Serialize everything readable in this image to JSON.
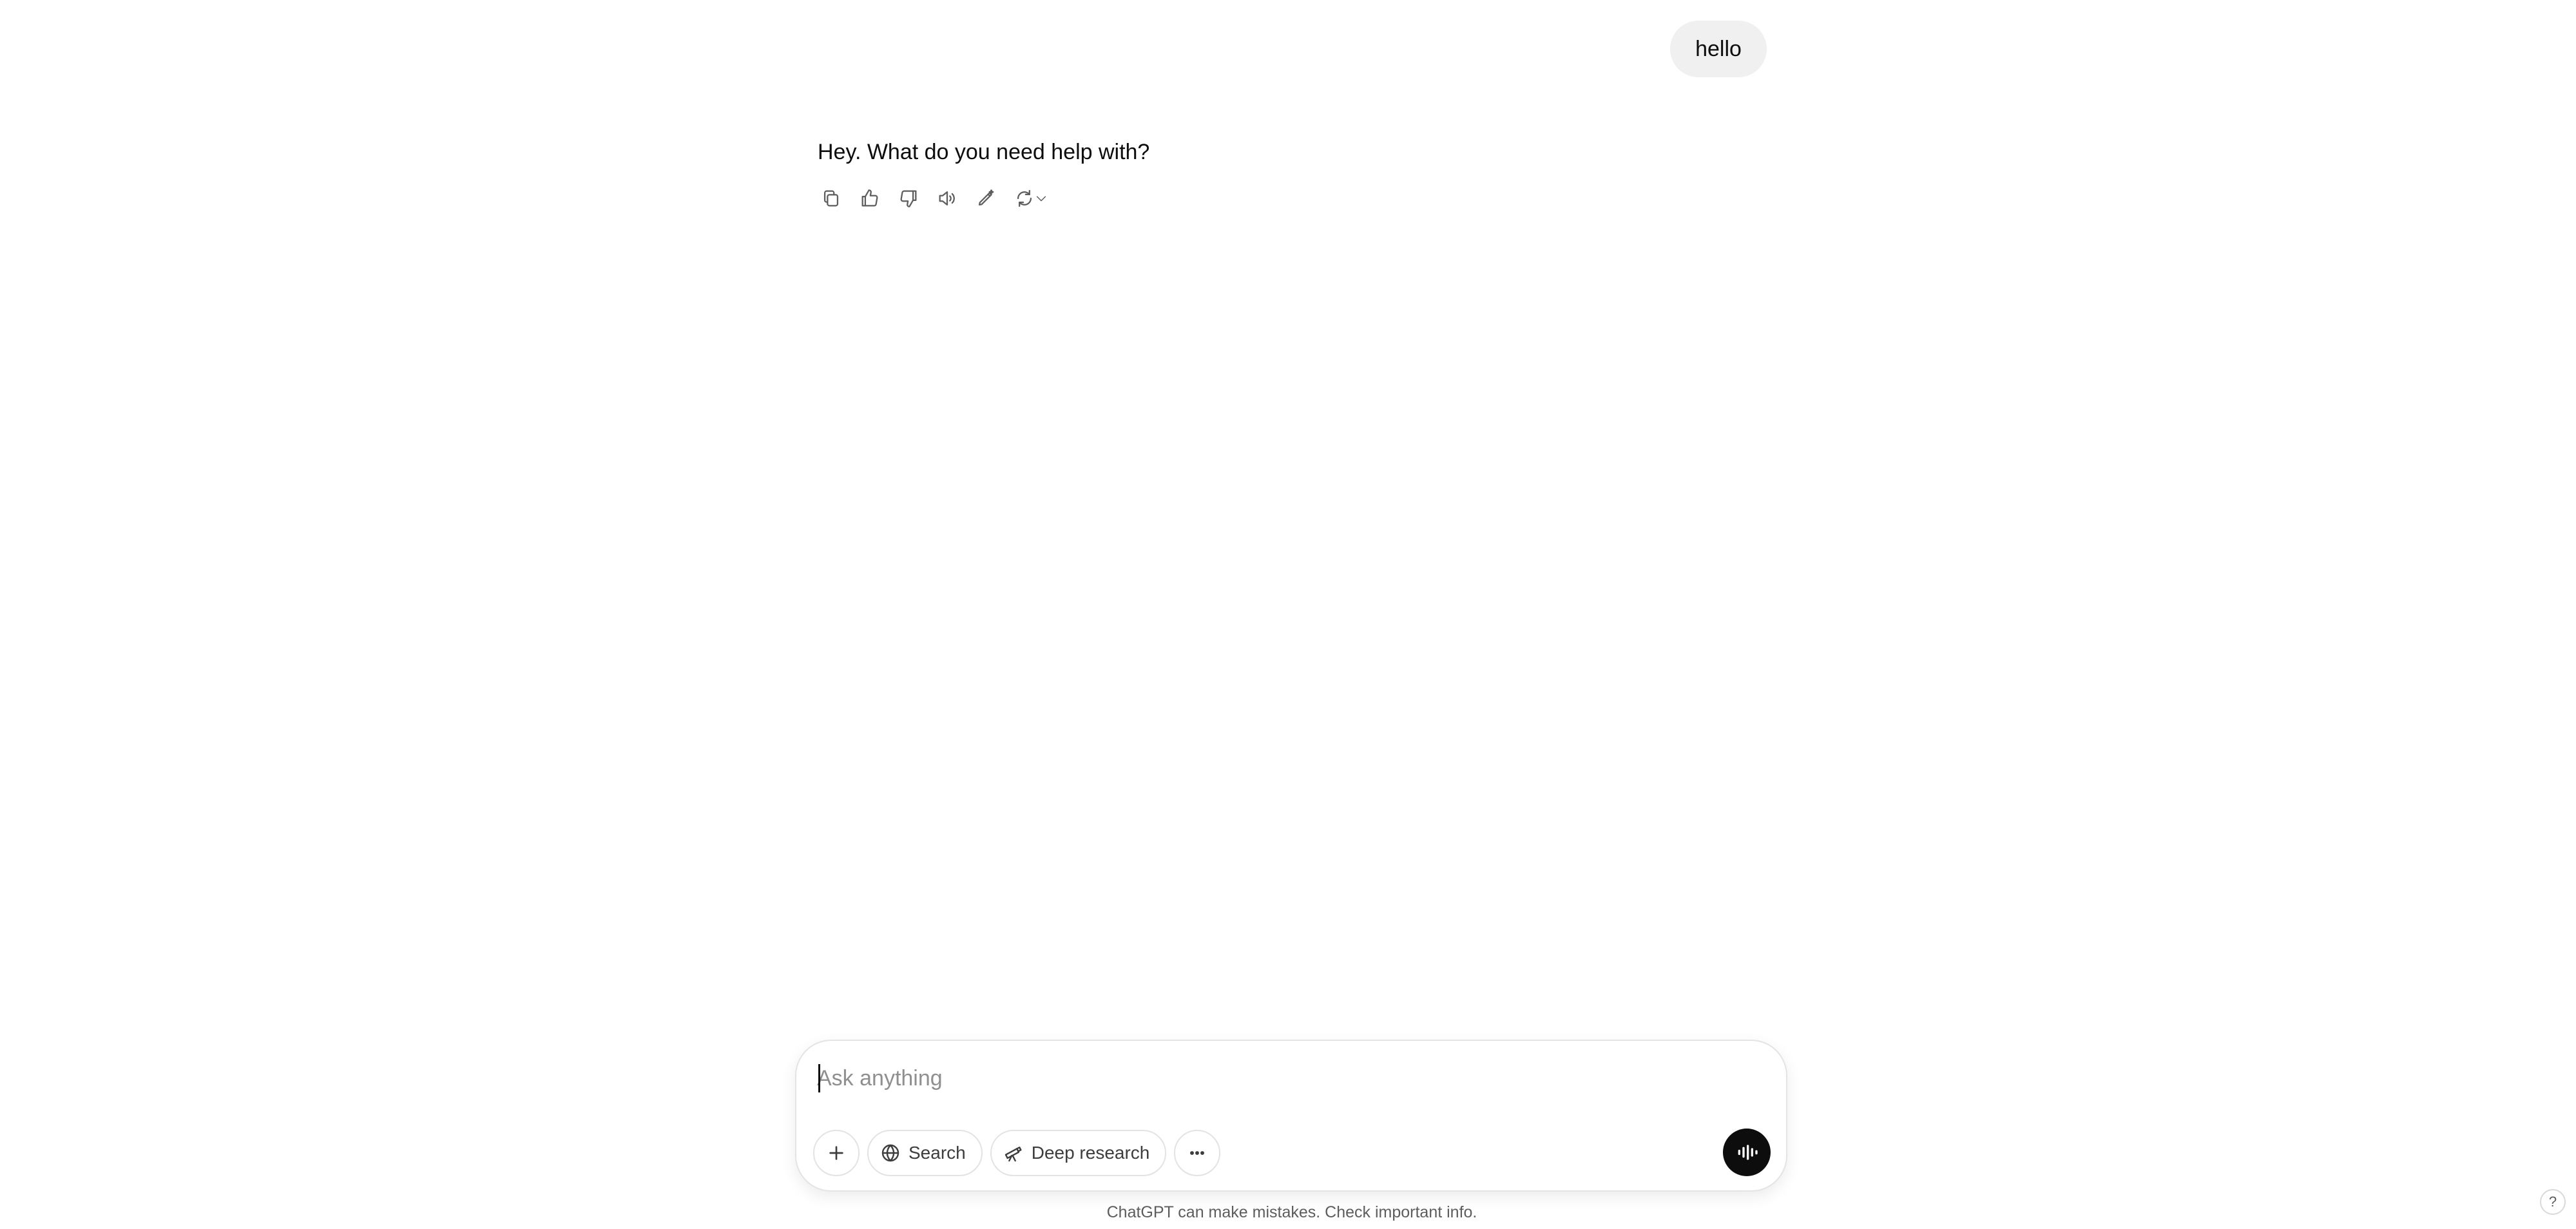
{
  "conversation": {
    "user_message": "hello",
    "assistant_message": "Hey. What do you need help with?",
    "actions": [
      {
        "name": "copy-icon"
      },
      {
        "name": "thumbs-up-icon"
      },
      {
        "name": "thumbs-down-icon"
      },
      {
        "name": "read-aloud-icon"
      },
      {
        "name": "edit-canvas-icon"
      },
      {
        "name": "regenerate-icon"
      }
    ]
  },
  "composer": {
    "placeholder": "Ask anything",
    "value": "",
    "tools": {
      "search_label": "Search",
      "deep_research_label": "Deep research"
    }
  },
  "footer": {
    "disclaimer": "ChatGPT can make mistakes. Check important info.",
    "help_label": "?"
  }
}
